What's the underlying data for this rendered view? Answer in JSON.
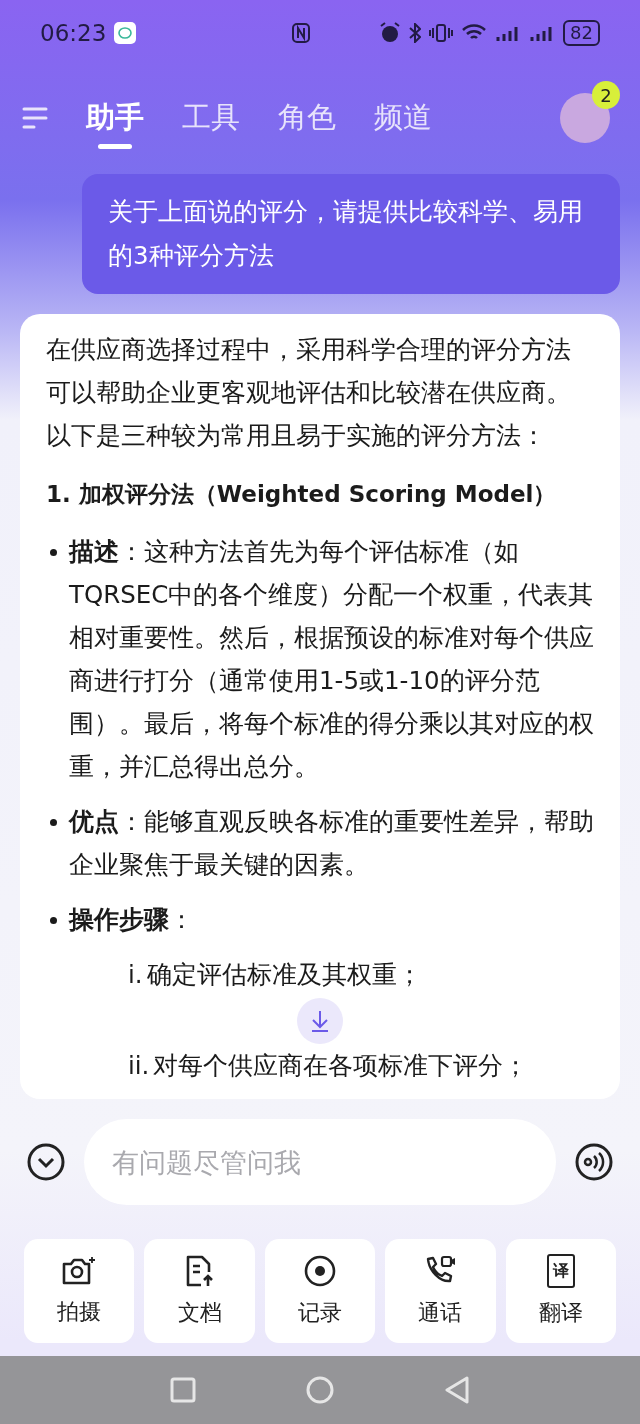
{
  "status_bar": {
    "time": "06:23",
    "battery": "82"
  },
  "header": {
    "tabs": [
      {
        "label": "助手",
        "selected": true
      },
      {
        "label": "工具",
        "selected": false
      },
      {
        "label": "角色",
        "selected": false
      },
      {
        "label": "频道",
        "selected": false
      }
    ],
    "avatar_badge": "2"
  },
  "user_message": "关于上面说的评分，请提供比较科学、易用的3种评分方法",
  "answer": {
    "intro": "在供应商选择过程中，采用科学合理的评分方法可以帮助企业更客观地评估和比较潜在供应商。以下是三种较为常用且易于实施的评分方法：",
    "heading": "1. 加权评分法（Weighted Scoring Model）",
    "bullets": [
      {
        "text": "**描述**：这种方法首先为每个评估标准（如TQRSEC中的各个维度）分配一个权重，代表其相对重要性。然后，根据预设的标准对每个供应商进行打分（通常使用1-5或1-10的评分范围）。最后，将每个标准的得分乘以其对应的权重，并汇总得出总分。"
      },
      {
        "text": "**优点**：能够直观反映各标准的重要性差异，帮助企业聚焦于最关键的因素。"
      },
      {
        "text": "**操作步骤**：",
        "steps": [
          {
            "marker": "i.",
            "text": "确定评估标准及其权重；"
          },
          {
            "marker": "ii.",
            "text": "对每个供应商在各项标准下评分；"
          }
        ]
      }
    ]
  },
  "input": {
    "placeholder": "有问题尽管问我"
  },
  "tools": [
    {
      "kind": "camera",
      "label": "拍摄"
    },
    {
      "kind": "document",
      "label": "文档"
    },
    {
      "kind": "record",
      "label": "记录"
    },
    {
      "kind": "call",
      "label": "通话"
    },
    {
      "kind": "translate",
      "label": "翻译",
      "icon_text": "译"
    }
  ]
}
